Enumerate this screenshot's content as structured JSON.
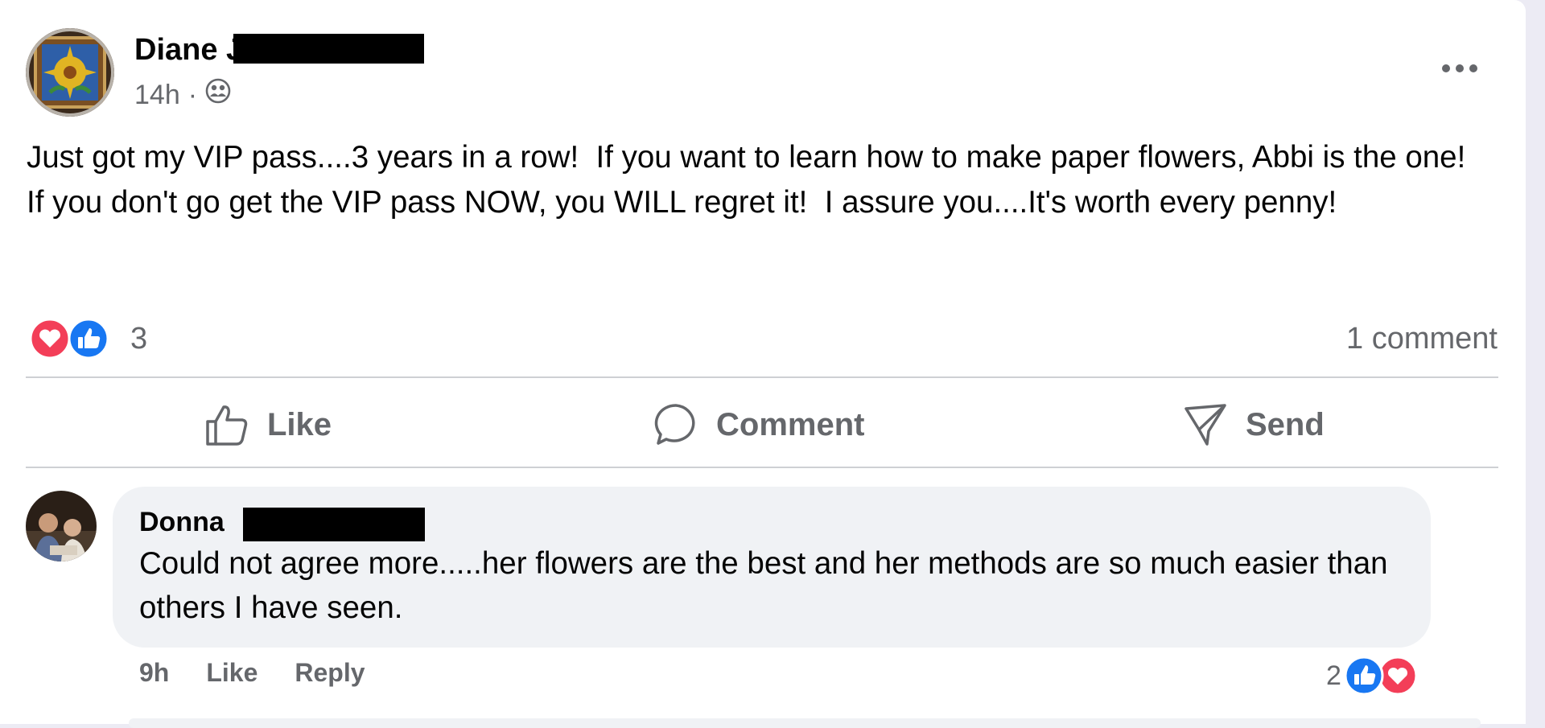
{
  "post": {
    "author": "Diane J",
    "time": "14h",
    "separator": "·",
    "audience_icon": "friends-icon",
    "more_icon": "more-horizontal-icon",
    "text": "Just got my VIP pass....3 years in a row!  If you want to learn how to make paper flowers, Abbi is the one!  If you don't go get the VIP pass NOW, you WILL regret it!  I assure you....It's worth every penny!",
    "reaction_count": "3",
    "comment_count": "1 comment",
    "reaction_icons": [
      "love-icon",
      "like-icon"
    ]
  },
  "actions": {
    "like": "Like",
    "comment": "Comment",
    "send": "Send"
  },
  "comment": {
    "author": "Donna",
    "text": "Could not agree more.....her flowers are the best and her methods are so much easier than others I have seen.",
    "time": "9h",
    "like": "Like",
    "reply": "Reply",
    "reaction_count": "2",
    "reaction_icons": [
      "like-icon",
      "love-icon"
    ]
  },
  "colors": {
    "like_blue": "#1877f2",
    "love_red": "#f33e58",
    "secondary_text": "#65676b",
    "bubble_bg": "#f0f2f5",
    "redaction": "#000000"
  }
}
